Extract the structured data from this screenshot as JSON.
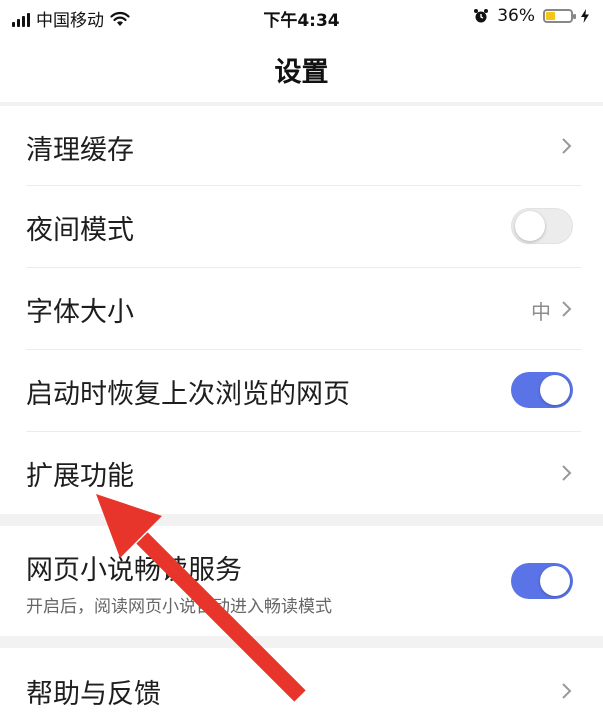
{
  "status_bar": {
    "carrier": "中国移动",
    "time": "下午4:34",
    "battery_percent": "36%",
    "battery_level": 0.36,
    "wifi_icon": "wifi-icon",
    "alarm_icon": "alarm-icon",
    "charging_icon": "charging-icon"
  },
  "nav": {
    "title": "设置"
  },
  "settings": {
    "clear_cache": {
      "label": "清理缓存"
    },
    "night_mode": {
      "label": "夜间模式",
      "enabled": false
    },
    "font_size": {
      "label": "字体大小",
      "value": "中"
    },
    "restore_pages": {
      "label": "启动时恢复上次浏览的网页",
      "enabled": true
    },
    "extensions": {
      "label": "扩展功能"
    },
    "novel_reader": {
      "label": "网页小说畅读服务",
      "description": "开启后，阅读网页小说自动进入畅读模式",
      "enabled": true
    },
    "help_feedback": {
      "label": "帮助与反馈"
    }
  },
  "colors": {
    "toggle_on": "#5a74e8",
    "toggle_off": "#ececec",
    "annotation_arrow": "#e8352b",
    "section_gap": "#f2f2f2"
  }
}
